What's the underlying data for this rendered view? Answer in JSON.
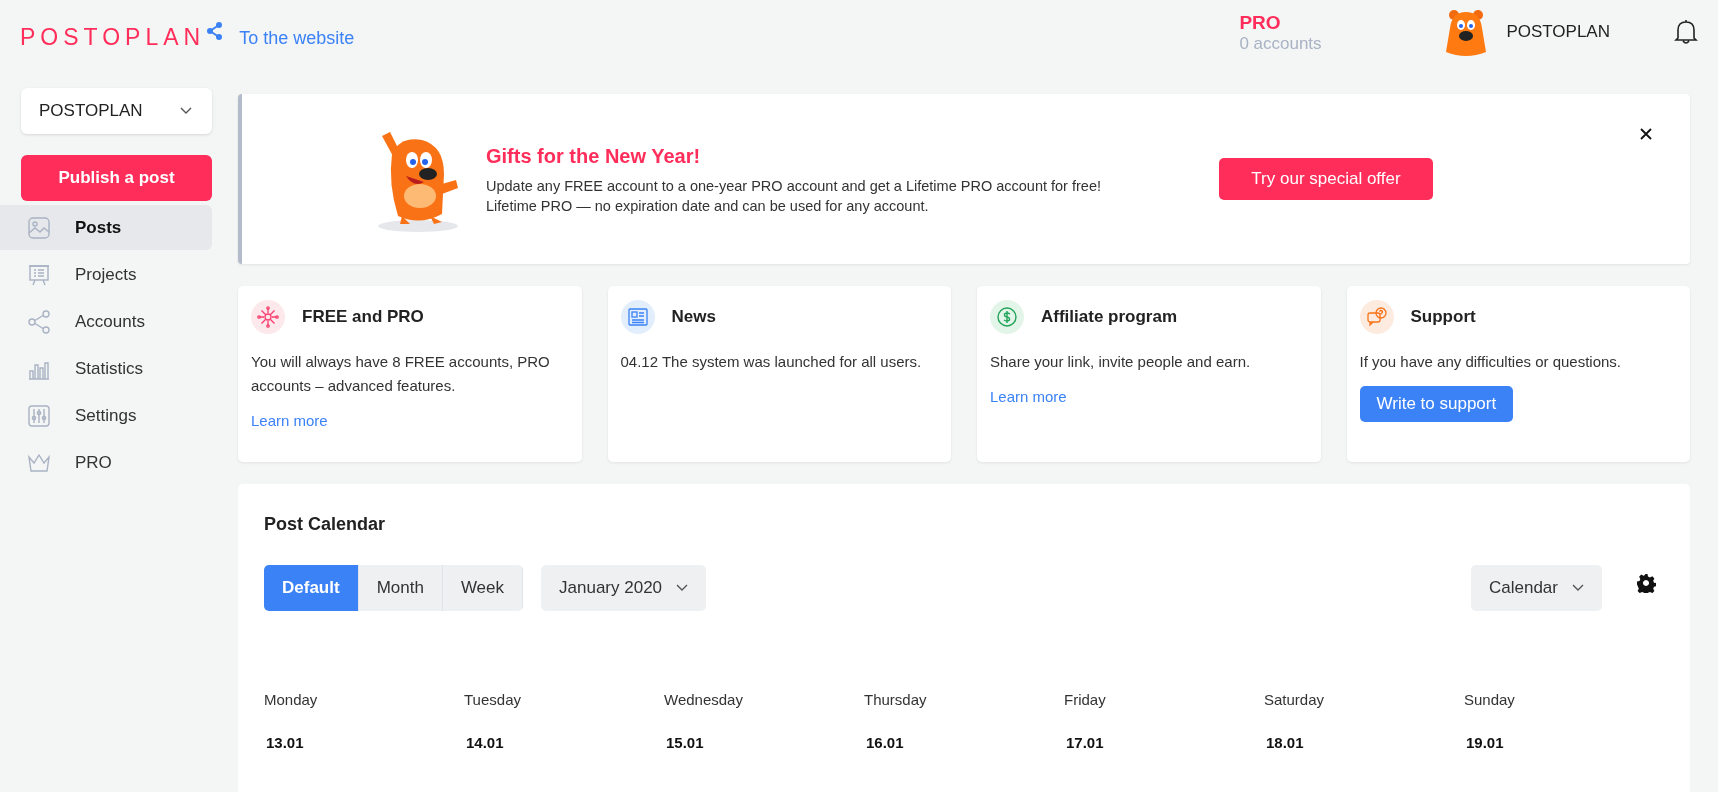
{
  "header": {
    "logo": "POSTOPLAN",
    "website_link": "To the website",
    "plan": "PRO",
    "accounts": "0 accounts",
    "user": "POSTOPLAN"
  },
  "sidebar": {
    "project_select": "POSTOPLAN",
    "publish_button": "Publish a post",
    "items": [
      {
        "label": "Posts",
        "kind": "image",
        "selected": true
      },
      {
        "label": "Projects",
        "kind": "board",
        "selected": false
      },
      {
        "label": "Accounts",
        "kind": "share",
        "selected": false
      },
      {
        "label": "Statistics",
        "kind": "bars",
        "selected": false
      },
      {
        "label": "Settings",
        "kind": "sliders",
        "selected": false
      },
      {
        "label": "PRO",
        "kind": "crown",
        "selected": false
      }
    ]
  },
  "banner": {
    "title": "Gifts for the New Year!",
    "lines": [
      "Update any FREE account to a one-year PRO account and get a Lifetime PRO account for free!",
      "Lifetime PRO — no expiration date and can be used for any account."
    ],
    "button": "Try our special offer"
  },
  "cards": [
    {
      "kind": "free",
      "title": "FREE and PRO",
      "text": "You will always have 8 FREE accounts, PRO accounts – advanced features.",
      "link": "Learn more"
    },
    {
      "kind": "news",
      "title": "News",
      "text": "04.12 The system was launched for all users."
    },
    {
      "kind": "affiliate",
      "title": "Affiliate program",
      "text": "Share your link, invite people and earn.",
      "link": "Learn more"
    },
    {
      "kind": "support",
      "title": "Support",
      "text": "If you have any difficulties or questions.",
      "button": "Write to support"
    }
  ],
  "calendar": {
    "title": "Post Calendar",
    "views": [
      {
        "label": "Default",
        "selected": true
      },
      {
        "label": "Month",
        "selected": false
      },
      {
        "label": "Week",
        "selected": false
      }
    ],
    "month": "January 2020",
    "mode": "Calendar",
    "days": [
      {
        "name": "Monday",
        "date": "13.01"
      },
      {
        "name": "Tuesday",
        "date": "14.01"
      },
      {
        "name": "Wednesday",
        "date": "15.01"
      },
      {
        "name": "Thursday",
        "date": "16.01"
      },
      {
        "name": "Friday",
        "date": "17.01"
      },
      {
        "name": "Saturday",
        "date": "18.01"
      },
      {
        "name": "Sunday",
        "date": "19.01"
      }
    ]
  }
}
